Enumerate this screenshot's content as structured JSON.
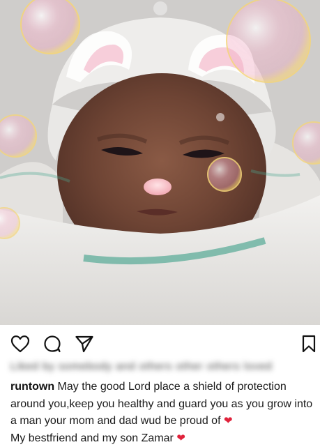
{
  "post": {
    "image_alt": "newborn baby with bunny ears filter and bubbles",
    "caption_user": "runtown",
    "caption_line1": " May the good Lord place a shield of protection around you,keep you healthy and guard you as you grow into a man your mom and dad wud be proud of ",
    "caption_line2": "My bestfriend and my son Zamar ",
    "heart": "❤",
    "blurred_likes_text": "Liked by somebody and others other others loved"
  },
  "icons": {
    "like": "heart-outline-icon",
    "comment": "comment-bubble-icon",
    "share": "paper-plane-icon",
    "save": "bookmark-icon"
  },
  "colors": {
    "heart_red": "#e0223b",
    "text": "#1a1a1a",
    "background": "#ffffff"
  }
}
